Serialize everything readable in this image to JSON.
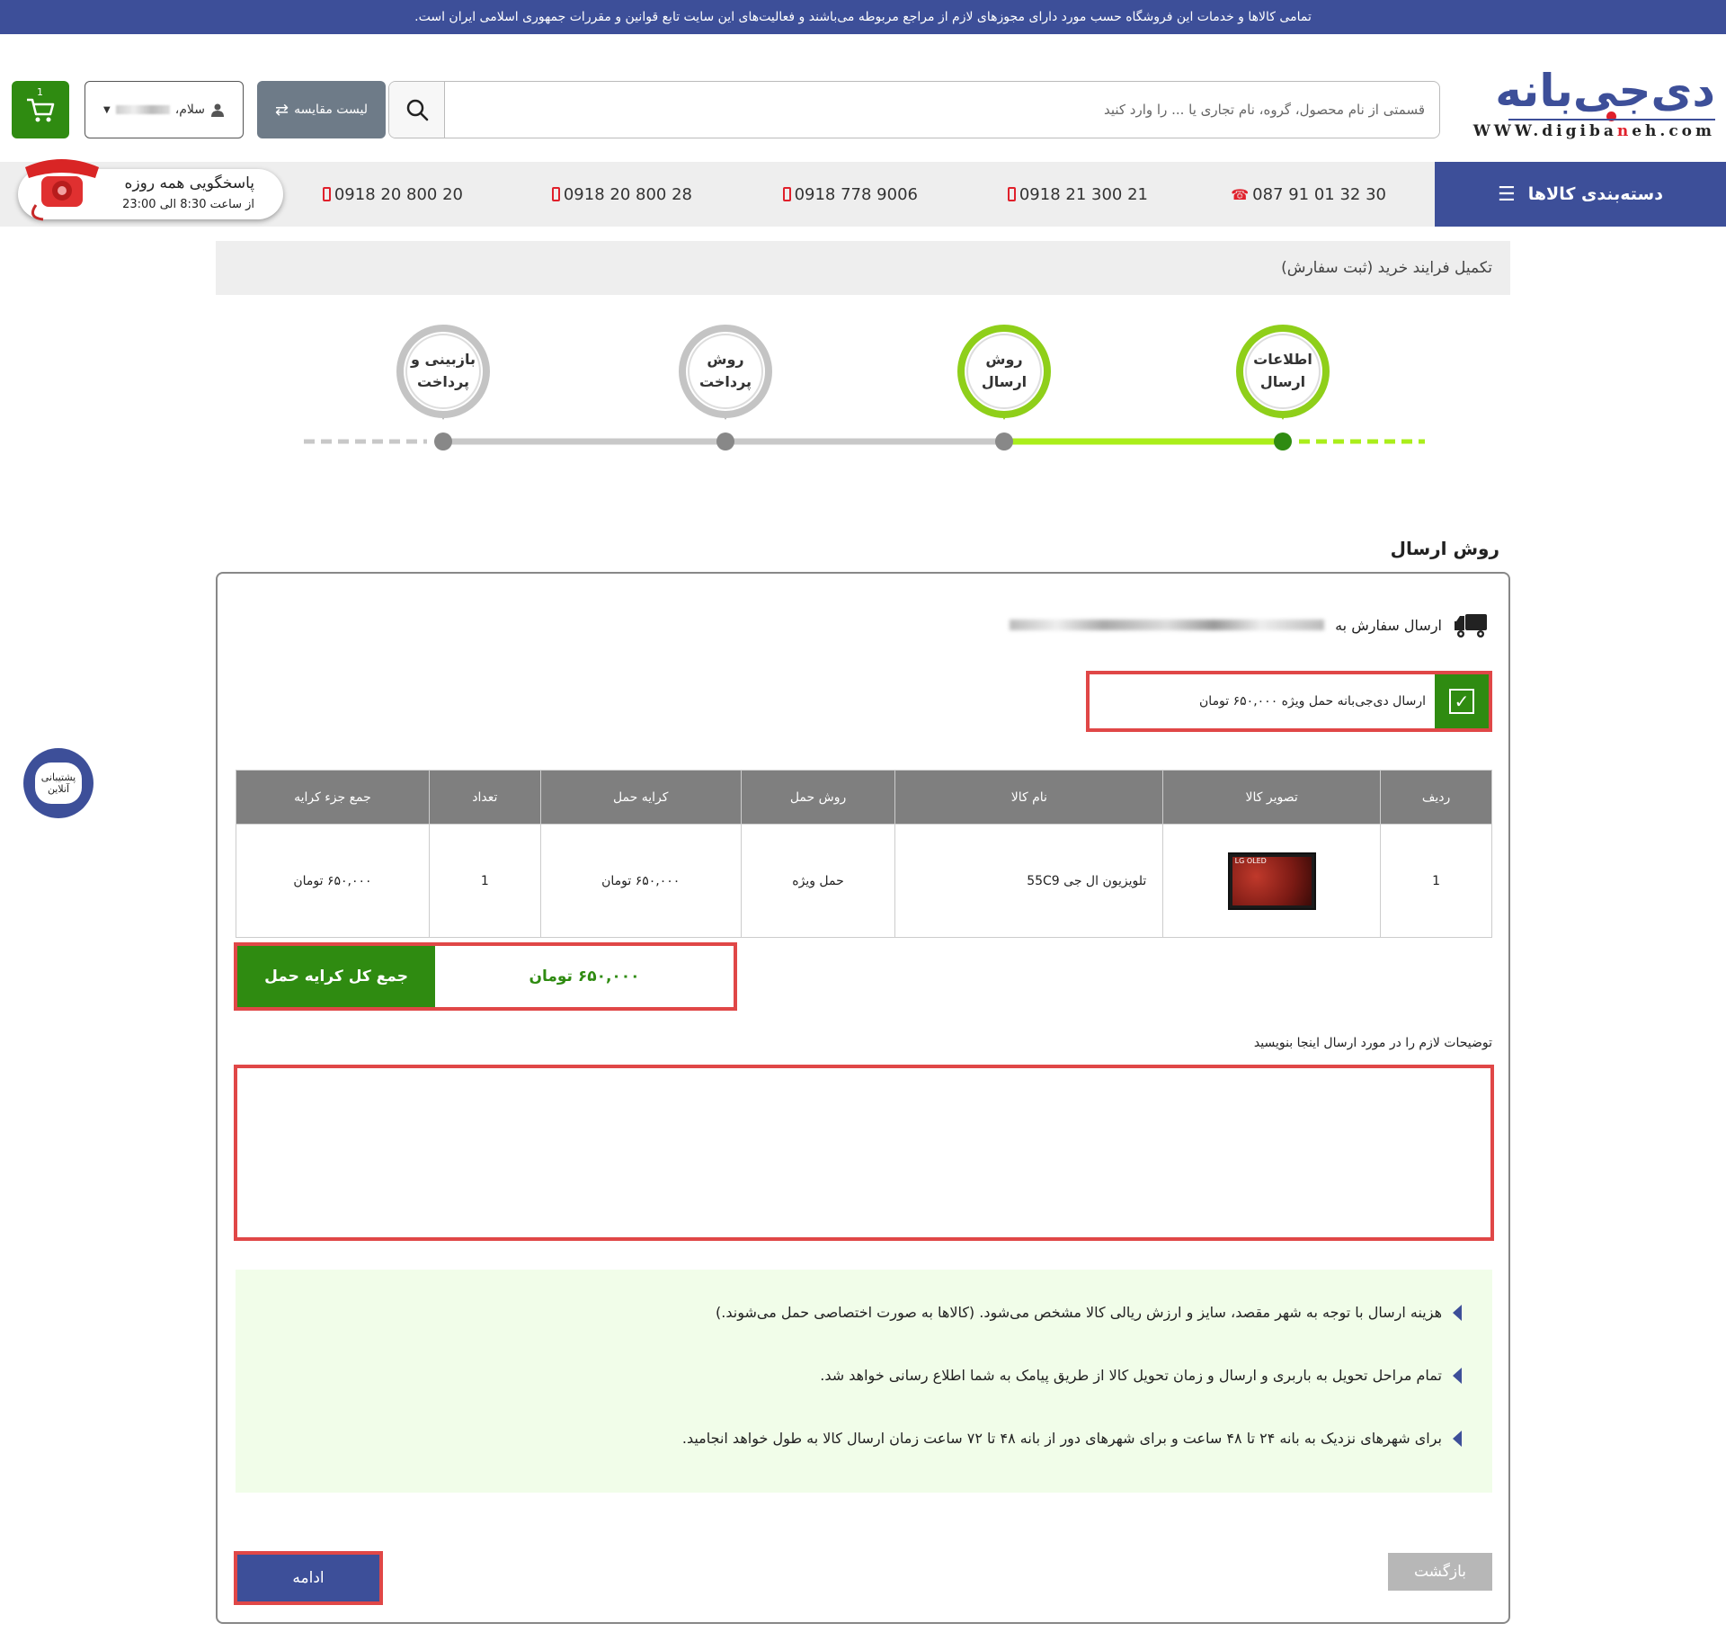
{
  "notice": "تمامی کالاها و خدمات این فروشگاه حسب مورد دارای مجوزهای لازم از مراجع مربوطه می‌باشند و فعالیت‌های این سایت تابع قوانین و مقررات جمهوری اسلامی ایران است.",
  "logo": {
    "word": "دی‌جی‌بانه",
    "url_prefix": "WWW.digiba",
    "url_highlight": "n",
    "url_suffix": "eh.com"
  },
  "search": {
    "placeholder": "قسمتی از نام محصول، گروه، نام تجاری یا ... را وارد کنید",
    "icon": "search-icon"
  },
  "compare": {
    "label": "لیست مقایسه",
    "icon": "swap-arrows-icon"
  },
  "user": {
    "greeting": "سلام،",
    "icon": "user-icon"
  },
  "cart": {
    "count": "1",
    "icon": "cart-icon"
  },
  "category_button": {
    "label": "دسته‌بندی کالاها",
    "icon": "menu-icon"
  },
  "phones": [
    {
      "number": "087 91 01 32 30",
      "icon": "telephone-icon"
    },
    {
      "number": "0918 21 300 21",
      "icon": "mobile-icon"
    },
    {
      "number": "0918 778 9006",
      "icon": "mobile-icon"
    },
    {
      "number": "0918 20 800 28",
      "icon": "mobile-icon"
    },
    {
      "number": "0918 20 800 20",
      "icon": "mobile-icon"
    }
  ],
  "support_hours": {
    "title": "پاسخگویی همه روزه",
    "hours": "از ساعت 8:30 الی 23:00"
  },
  "page_title": "تکمیل فرایند خرید (ثبت سفارش)",
  "steps": [
    {
      "line1": "اطلاعات",
      "line2": "ارسال",
      "state": "done"
    },
    {
      "line1": "روش",
      "line2": "ارسال",
      "state": "active"
    },
    {
      "line1": "روش",
      "line2": "پرداخت",
      "state": "pending"
    },
    {
      "line1": "بازبینی و",
      "line2": "پرداخت",
      "state": "pending"
    }
  ],
  "colors": {
    "brand": "#3d4f99",
    "accent_green": "#2f8b11",
    "step_green": "#aaee1a",
    "highlight_red": "#e04747",
    "info_bg": "#f1fde9"
  },
  "shipping": {
    "heading": "روش ارسال",
    "ship_to_label": "ارسال سفارش به",
    "truck_icon": "truck-icon",
    "option_label": "ارسال دی‌جی‌بانه حمل ویژه ۶۵۰,۰۰۰ تومان",
    "option_checked": true
  },
  "table": {
    "headers": [
      "ردیف",
      "تصویر کالا",
      "نام کالا",
      "روش حمل",
      "کرایه حمل",
      "تعداد",
      "جمع جزء کرایه"
    ],
    "rows": [
      {
        "index": "1",
        "image_brand": "LG OLED",
        "name": "تلویزیون ال جی 55C9",
        "method": "حمل ویژه",
        "fee": "۶۵۰,۰۰۰ تومان",
        "qty": "1",
        "subtotal": "۶۵۰,۰۰۰ تومان"
      }
    ]
  },
  "total": {
    "label": "جمع کل کرایه حمل",
    "value": "۶۵۰,۰۰۰ تومان"
  },
  "notes": {
    "label": "توضیحات لازم را در مورد ارسال اینجا بنویسید",
    "value": ""
  },
  "info": [
    "هزینه ارسال با توجه به شهر مقصد، سایز و ارزش ریالی کالا مشخص می‌شود. (کالاها به صورت اختصاصی حمل می‌شوند.)",
    "تمام مراحل تحویل به باربری و ارسال و زمان تحویل کالا از طریق پیامک به شما اطلاع رسانی خواهد شد.",
    "برای شهرهای نزدیک به بانه ۲۴ تا ۴۸ ساعت و برای شهرهای دور از بانه ۴۸ تا ۷۲ ساعت زمان ارسال کالا به طول خواهد انجامید."
  ],
  "buttons": {
    "continue": "ادامه",
    "back": "بازگشت"
  },
  "online_support": {
    "line1": "پشتیبانی",
    "line2": "آنلاین"
  }
}
